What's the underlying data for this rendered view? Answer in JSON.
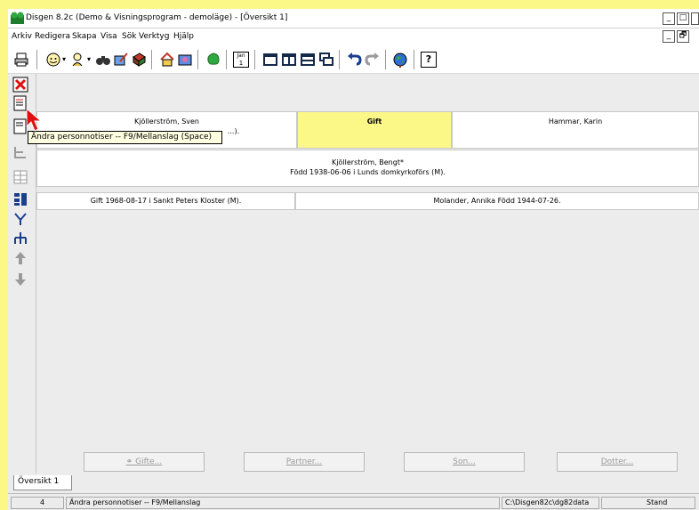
{
  "window": {
    "title": "Disgen 8.2c (Demo & Visningsprogram - demoläge) - [Översikt 1]",
    "controls": [
      "_",
      "□",
      "×"
    ],
    "mdi_controls": [
      "_",
      "🗗"
    ]
  },
  "menu": [
    "Arkiv",
    "Redigera",
    "Skapa",
    "Visa",
    "Sök",
    "Verktyg",
    "Hjälp"
  ],
  "toolbar": {
    "calendar_label": "Jan",
    "calendar_day": "1",
    "help_label": "?"
  },
  "family": {
    "father_name": "Kjöllerström, Sven",
    "father_detail": "...).",
    "marriage_status": "Gift",
    "mother_name": "Hammar, Karin",
    "person_name": "Kjöllerström, Bengt*",
    "person_born": "Född 1938-06-06 i Lunds domkyrkoförs (M).",
    "marriage_event": "Gift 1968-08-17 i Sankt Peters Kloster (M).",
    "spouse": "Molander, Annika Född 1944-07-26."
  },
  "tooltip": "Ändra personnotiser -- F9/Mellanslag (Space)",
  "buttons": {
    "gifte": "Gifte...",
    "partner": "Partner...",
    "son": "Son...",
    "dotter": "Dotter..."
  },
  "tabs": [
    "Översikt 1"
  ],
  "status": {
    "count": "4",
    "message": "Ändra personnotiser -- F9/Mellanslag",
    "path": "C:\\Disgen82c\\dg82data",
    "mode": "Stand"
  },
  "colors": {
    "background": "#fcf888",
    "highlight_cell": "#fcf888",
    "cursor_red": "#e01010"
  }
}
